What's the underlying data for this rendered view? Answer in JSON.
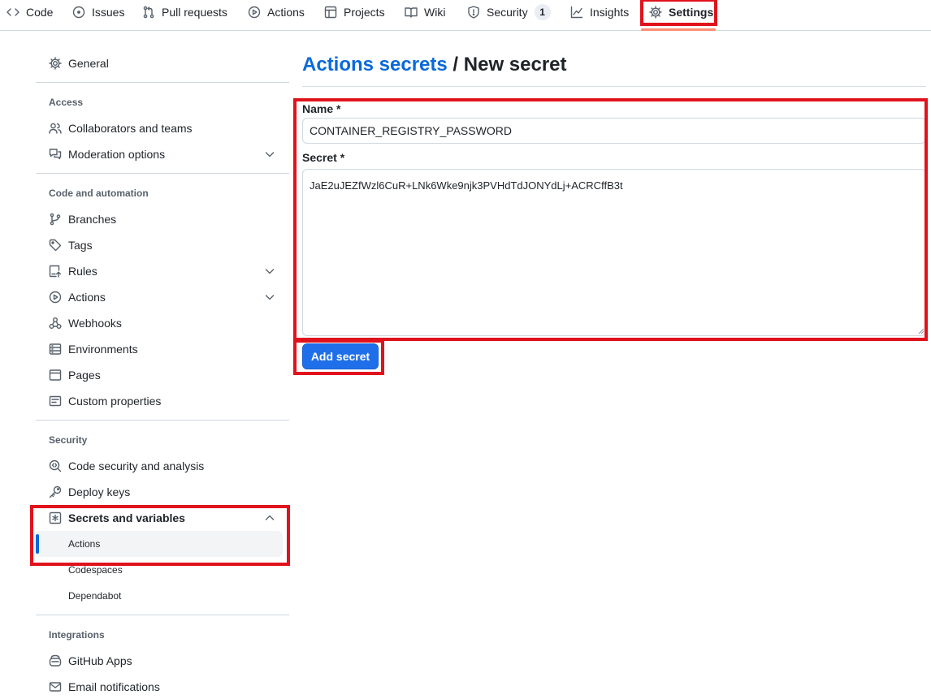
{
  "repo_nav": {
    "tabs": [
      {
        "label": "Code",
        "icon": "code-icon"
      },
      {
        "label": "Issues",
        "icon": "issue-opened-icon"
      },
      {
        "label": "Pull requests",
        "icon": "git-pull-request-icon"
      },
      {
        "label": "Actions",
        "icon": "play-icon"
      },
      {
        "label": "Projects",
        "icon": "table-icon"
      },
      {
        "label": "Wiki",
        "icon": "book-icon"
      },
      {
        "label": "Security",
        "icon": "shield-icon",
        "counter": "1"
      },
      {
        "label": "Insights",
        "icon": "graph-icon"
      },
      {
        "label": "Settings",
        "icon": "gear-icon",
        "selected": true
      }
    ]
  },
  "sidebar": {
    "general": "General",
    "access": {
      "heading": "Access",
      "items": [
        "Collaborators and teams",
        "Moderation options"
      ]
    },
    "code_automation": {
      "heading": "Code and automation",
      "items": [
        "Branches",
        "Tags",
        "Rules",
        "Actions",
        "Webhooks",
        "Environments",
        "Pages",
        "Custom properties"
      ]
    },
    "security": {
      "heading": "Security",
      "items": [
        "Code security and analysis",
        "Deploy keys",
        "Secrets and variables"
      ],
      "secrets_sub": [
        "Actions",
        "Codespaces",
        "Dependabot"
      ]
    },
    "integrations": {
      "heading": "Integrations",
      "items": [
        "GitHub Apps",
        "Email notifications"
      ]
    }
  },
  "main": {
    "breadcrumb_link": "Actions secrets",
    "separator": " / ",
    "title": "New secret",
    "name_label": "Name *",
    "name_value": "CONTAINER_REGISTRY_PASSWORD",
    "secret_label": "Secret *",
    "secret_value": "JaE2uJEZfWzl6CuR+LNk6Wke9njk3PVHdTdJONYdLj+ACRCffB3t",
    "add_button": "Add secret"
  },
  "colors": {
    "accent": "#0969da",
    "button": "#1f6feb",
    "highlight": "#e0121c",
    "tab_underline": "#fd8c73"
  }
}
